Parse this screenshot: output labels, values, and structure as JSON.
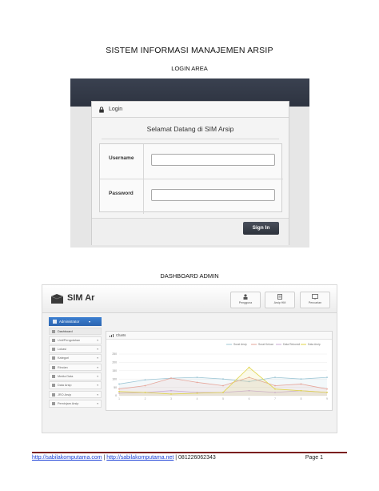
{
  "document": {
    "title": "SISTEM INFORMASI MANAJEMEN ARSIP",
    "section_login": "LOGIN AREA",
    "section_dashboard": "DASHBOARD ADMIN"
  },
  "login": {
    "panel_title": "Login",
    "welcome": "Selamat Datang di SIM Arsip",
    "username_label": "Username",
    "password_label": "Password",
    "username_value": "",
    "password_value": "",
    "signin_label": "Sign In",
    "lock_icon": "lock-icon"
  },
  "dashboard": {
    "logo_text": "SIM Ar",
    "quick_buttons": [
      "Pengguna",
      "Arsip HM",
      "Pencarian"
    ],
    "user_label": "Administrator",
    "menu": [
      "Dashboard",
      "Unit/Pengolahan",
      "Lokasi",
      "Kategori",
      "Rincian",
      "Media Data",
      "Data Arsip",
      "JRO Arsip",
      "Peminjam Arsip"
    ],
    "chart_title": "Charts"
  },
  "chart_data": {
    "type": "line",
    "title": "",
    "xlabel": "",
    "ylabel": "",
    "ylim": [
      0,
      250
    ],
    "y_ticks": [
      "0",
      "50",
      "100",
      "150",
      "200",
      "250"
    ],
    "categories": [
      "1",
      "2",
      "3",
      "4",
      "5",
      "6",
      "7",
      "8",
      "9"
    ],
    "legend_position": "top",
    "series": [
      {
        "name": "Surat Arsip",
        "color": "#9fc7d6",
        "values": [
          70,
          95,
          105,
          110,
          100,
          85,
          110,
          100,
          110
        ]
      },
      {
        "name": "Surat Keluar",
        "color": "#e6a59a",
        "values": [
          40,
          60,
          105,
          80,
          60,
          110,
          60,
          70,
          40
        ]
      },
      {
        "name": "Data Rekonsil",
        "color": "#c9a9d6",
        "values": [
          15,
          20,
          30,
          20,
          20,
          30,
          20,
          30,
          20
        ]
      },
      {
        "name": "Data Arsip",
        "color": "#e0d44a",
        "values": [
          25,
          20,
          10,
          15,
          20,
          170,
          40,
          30,
          20
        ]
      }
    ]
  },
  "footer": {
    "link1": "http://sabilakomputama.com",
    "separator1": " | ",
    "link2": "http://sabilakomputama.net",
    "separator2": " | 081226062343",
    "page": "Page 1"
  }
}
